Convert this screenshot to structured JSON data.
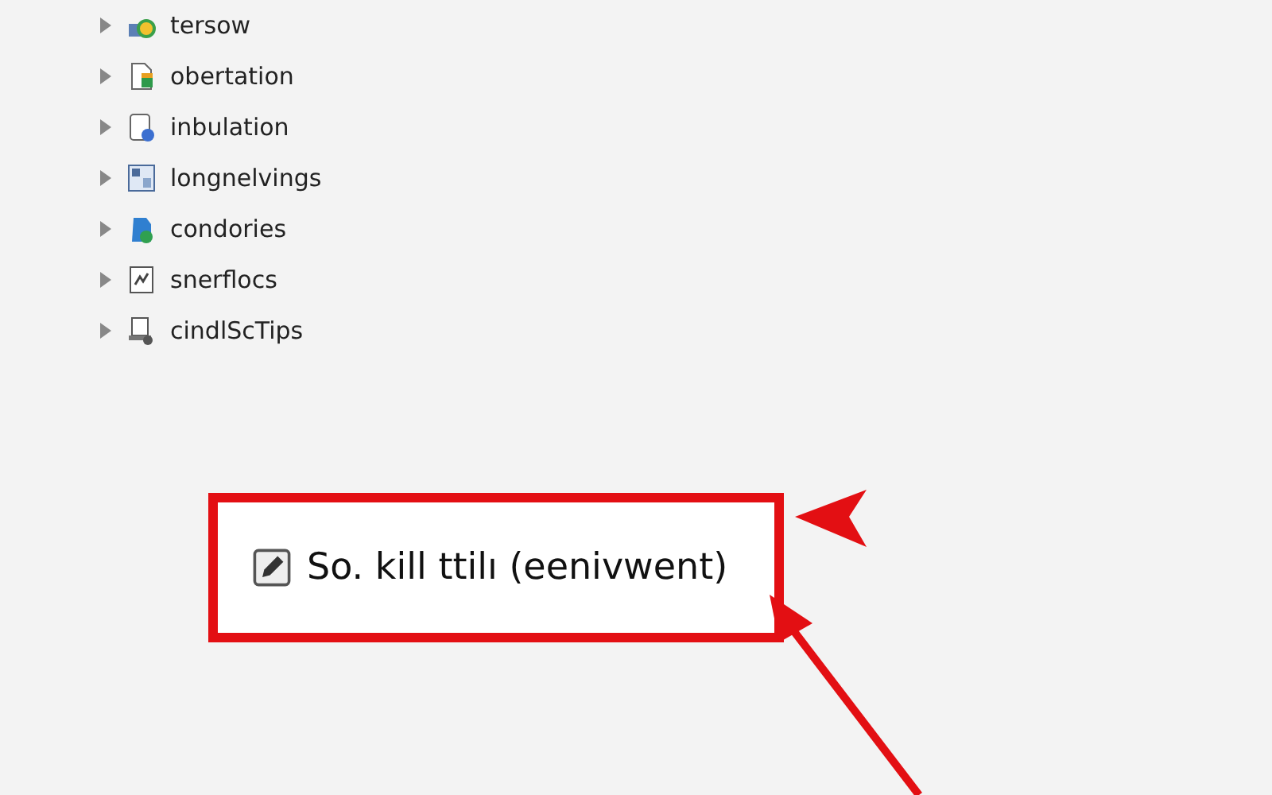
{
  "tree": {
    "items": [
      {
        "label": "tersow",
        "expanded": false
      },
      {
        "label": "obertation",
        "expanded": false
      },
      {
        "label": "inbulation",
        "expanded": false
      },
      {
        "label": "longnelvings",
        "expanded": false
      },
      {
        "label": "condories",
        "expanded": false
      },
      {
        "label": "snerflocs",
        "expanded": false
      },
      {
        "label": "cindlScTips",
        "expanded": false
      }
    ]
  },
  "callout": {
    "text": "So. kill ttilı (eenivwent)"
  }
}
